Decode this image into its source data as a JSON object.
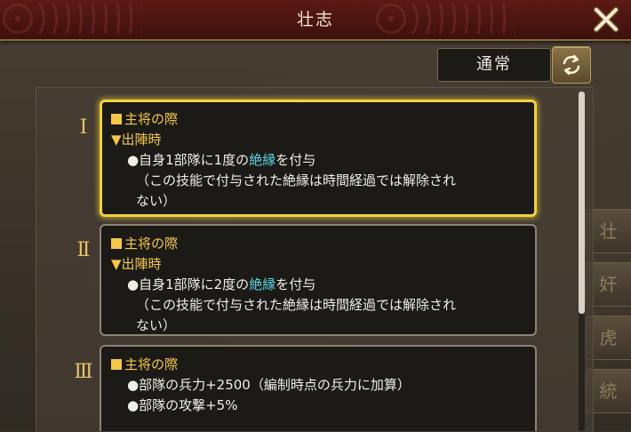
{
  "window": {
    "title": "壮志"
  },
  "toolbar": {
    "mode_label": "通常"
  },
  "tiers": [
    {
      "numeral": "Ⅰ",
      "selected": true,
      "condition": "主将の際",
      "trigger": "▼出陣時",
      "effect_pre": "●自身1部隊に1度の",
      "effect_keyword": "絶縁",
      "effect_post": "を付与",
      "note_line1": "（この技能で付与された絶縁は時間経過では解除され",
      "note_line2": "ない）"
    },
    {
      "numeral": "Ⅱ",
      "selected": false,
      "condition": "主将の際",
      "trigger": "▼出陣時",
      "effect_pre": "●自身1部隊に2度の",
      "effect_keyword": "絶縁",
      "effect_post": "を付与",
      "note_line1": "（この技能で付与された絶縁は時間経過では解除され",
      "note_line2": "ない）"
    },
    {
      "numeral": "Ⅲ",
      "selected": false,
      "condition": "主将の際",
      "line1": "●部隊の兵力+2500（編制時点の兵力に加算）",
      "line2": "●部隊の攻撃+5%"
    }
  ],
  "background": {
    "side_tabs": [
      "壮",
      "奸",
      "虎",
      "統"
    ]
  },
  "colors": {
    "accent_gold": "#f4c84a",
    "keyword_cyan": "#5ad4e6",
    "selected_border": "#f1d23a",
    "titlebar": "#4a1411"
  },
  "icons": {
    "close": "close-icon",
    "refresh": "refresh-icon"
  }
}
